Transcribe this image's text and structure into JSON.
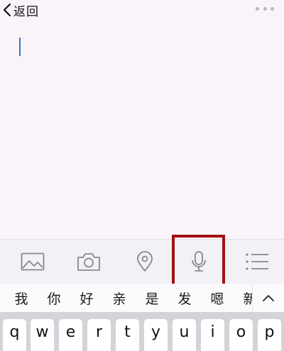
{
  "nav": {
    "back_label": "返回"
  },
  "toolbar": {
    "tools": [
      "image-icon",
      "camera-icon",
      "location-pin-icon",
      "microphone-icon",
      "list-icon"
    ],
    "highlight_color": "#a11214"
  },
  "candidates": {
    "words": [
      "我",
      "你",
      "好",
      "亲",
      "是",
      "发",
      "嗯",
      "新"
    ]
  },
  "keyboard": {
    "row1": [
      "q",
      "w",
      "e",
      "r",
      "t",
      "y",
      "u",
      "i",
      "o",
      "p"
    ]
  },
  "colors": {
    "background": "#f8f4fa",
    "caret": "#3e74c4"
  }
}
